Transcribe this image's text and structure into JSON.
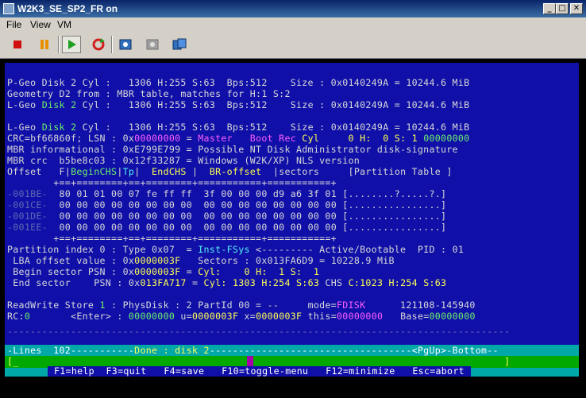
{
  "window": {
    "title": "W2K3_SE_SP2_FR on",
    "min_glyph": "_",
    "max_glyph": "□",
    "close_glyph": "✕"
  },
  "menu": {
    "file": "File",
    "view": "View",
    "vm": "VM"
  },
  "toolbar": {
    "stop_icon": "stop-icon",
    "pause_icon": "pause-icon",
    "play_icon": "play-icon",
    "reset_icon": "reset-icon",
    "snapshot_icon": "snapshot-icon",
    "revert_icon": "revert-icon",
    "manage_icon": "manage-snapshots-icon"
  },
  "colors": {
    "console_bg": "#1010a8",
    "status_bar": "#00a8a8",
    "input_bar": "#00a800",
    "highlight_magenta": "#ff5cff",
    "highlight_yellow": "#ffff54"
  },
  "console": {
    "l1": "P-Geo Disk 2 Cyl :   1306 H:255 S:63  Bps:512    Size : 0x0140249A = 10244.6 MiB",
    "l2": "Geometry D2 from : MBR table, matches for H:1 S:2",
    "l3a": "L-Geo ",
    "l3b": "Disk 2",
    "l3c": " Cyl :   1306 H:255 S:63  Bps:512    Size : 0x0140249A = 10244.6 MiB",
    "l4a": "L-Geo ",
    "l4b": "Disk 2",
    "l4c": " Cyl :   1306 H:255 S:63  Bps:512    Size : 0x0140249A = 10244.6 MiB",
    "crc_a": "CRC=bf66860f; LSN : 0x",
    "crc_b": "00000000",
    "crc_c": " = ",
    "crc_d": "Master   Boot Rec",
    "crc_e": " Cyl     0 H:  0 S: 1 ",
    "crc_f": "00000000",
    "mbr_info": "MBR informational : 0xE799E799 = Possible NT Disk Administrator disk-signature",
    "mbr_crc": "MBR crc  b5be8c03 : 0x12f33287 = Windows (W2K/XP) NLS version",
    "hdr_a": "Offset   F|",
    "hdr_b": "BeginCHS",
    "hdr_c": "|",
    "hdr_d": "Tp",
    "hdr_e": "|  ",
    "hdr_f": "EndCHS",
    "hdr_g": " |  ",
    "hdr_h": "BR-offset",
    "hdr_i": "  |sectors     [Partition Table ]",
    "rule": "        +==+========+==+========+===========+===========+",
    "r1_off": "-001BE-",
    "r1_hex": "  80 01 01 00 07 fe ff ff  3f 00 00 00 d9 a6 3f 01 ",
    "r1_asc": "[........?.....?.]",
    "r2_off": "-001CE-",
    "r2_hex": "  00 00 00 00 00 00 00 00  00 00 00 00 00 00 00 00 ",
    "r2_asc": "[................]",
    "r3_off": "-001DE-",
    "r3_hex": "  00 00 00 00 00 00 00 00  00 00 00 00 00 00 00 00 ",
    "r3_asc": "[................]",
    "r4_off": "-001EE-",
    "r4_hex": "  00 00 00 00 00 00 00 00  00 00 00 00 00 00 00 00 ",
    "r4_asc": "[................]",
    "pi_a": "Partition index 0 : Type 0x07  = ",
    "pi_b": "Inst-FSys",
    "pi_c": " <--------- Active/Bootable  PID : 01",
    "lba_a": " LBA offset value : 0x",
    "lba_b": "0000003F",
    "lba_c": "   Sectors : 0x013FA6D9 = 10228.9 MiB",
    "bs_a": " Begin sector PSN : 0x",
    "bs_b": "0000003F",
    "bs_c": " = ",
    "bs_d": "Cyl:    0 H:  1 S:  1",
    "es_a": " End sector    PSN : 0x",
    "es_b": "013FA717",
    "es_c": " = ",
    "es_d": "Cyl: 1303 H:254 S:63",
    "es_e": " CHS ",
    "es_f": "C:1023 H:254 S:63",
    "rw_a": "ReadWrite Store ",
    "rw_b": "1",
    "rw_c": " : PhysDisk : 2 PartId 00 = --     mode=",
    "rw_d": "FDISK",
    "rw_e": "      121108-145940",
    "rc_a": "RC:",
    "rc_b": "0",
    "rc_c": "       <Enter> : ",
    "rc_d": "00000000",
    "rc_e": " u=",
    "rc_f": "0000003F",
    "rc_g": " x=",
    "rc_h": "0000003F",
    "rc_i": " this=",
    "rc_j": "00000000",
    "rc_k": "   Base=",
    "rc_l": "00000000",
    "dash": "---------------------------------------------------------------------------------------",
    "status_a": "-Lines  102-----------",
    "status_b": "Done : disk 2",
    "status_c": "-----------------------------------<PgUp>-Bottom--",
    "input": "[_                                                                                    ]",
    "keys": "F1=help  F3=quit   F4=save   F10=toggle-menu   F12=minimize   Esc=abort"
  }
}
